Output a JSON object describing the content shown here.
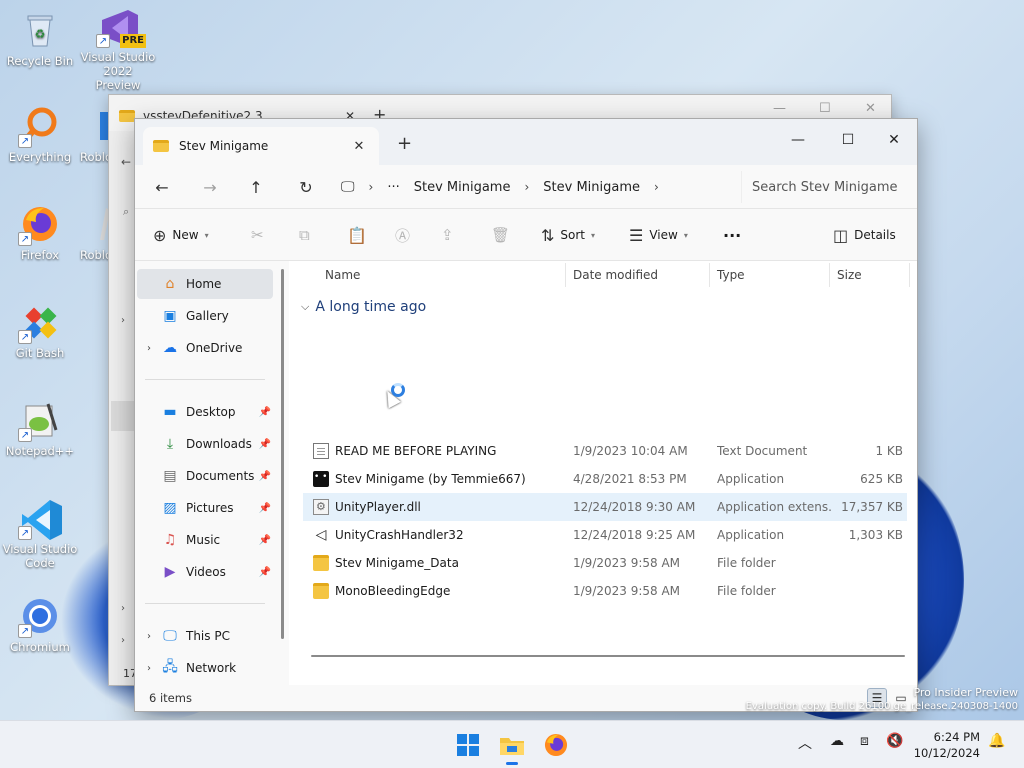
{
  "desktop": {
    "icons": [
      {
        "label": "Recycle Bin",
        "icon": "recycle-bin-icon"
      },
      {
        "label": "Visual Studio 2022 Preview",
        "badge": "PRE",
        "icon": "visual-studio-icon"
      },
      {
        "label": "Everything",
        "icon": "everything-search-icon"
      },
      {
        "label": "Roblo",
        "icon": "roblox-icon"
      },
      {
        "label": "Firefox",
        "icon": "firefox-icon"
      },
      {
        "label": "Roblo",
        "icon": "roblox-studio-icon"
      },
      {
        "label": "Git Bash",
        "icon": "git-bash-icon"
      },
      {
        "label": "Notepad++",
        "icon": "notepad-plus-plus-icon"
      },
      {
        "label": "Visual Studio Code",
        "icon": "vscode-icon"
      },
      {
        "label": "Chromium",
        "icon": "chromium-icon"
      }
    ]
  },
  "background_window": {
    "tab_title": "vsstevDefenitive2.3",
    "status_prefix": "17"
  },
  "window": {
    "tab_title": "Stev Minigame",
    "new_tab": "+",
    "controls": {
      "minimize": "—",
      "maximize": "☐",
      "close": "✕"
    }
  },
  "address": {
    "overflow": "···",
    "crumbs": [
      "Stev Minigame",
      "Stev Minigame"
    ],
    "search_placeholder": "Search Stev Minigame"
  },
  "toolbar": {
    "new_label": "New",
    "sort_label": "Sort",
    "view_label": "View",
    "more_label": "···",
    "details_label": "Details"
  },
  "sidebar": {
    "items": [
      {
        "label": "Home",
        "icon": "home-icon",
        "selected": true
      },
      {
        "label": "Gallery",
        "icon": "gallery-icon"
      },
      {
        "label": "OneDrive",
        "icon": "onedrive-icon",
        "expandable": true
      },
      {
        "label": "Desktop",
        "icon": "desktop-folder-icon",
        "pinned": true
      },
      {
        "label": "Downloads",
        "icon": "downloads-icon",
        "pinned": true
      },
      {
        "label": "Documents",
        "icon": "documents-icon",
        "pinned": true
      },
      {
        "label": "Pictures",
        "icon": "pictures-icon",
        "pinned": true
      },
      {
        "label": "Music",
        "icon": "music-icon",
        "pinned": true
      },
      {
        "label": "Videos",
        "icon": "videos-icon",
        "pinned": true
      },
      {
        "label": "This PC",
        "icon": "this-pc-icon",
        "expandable": true
      },
      {
        "label": "Network",
        "icon": "network-icon",
        "expandable": true
      }
    ]
  },
  "files": {
    "columns": [
      "Name",
      "Date modified",
      "Type",
      "Size"
    ],
    "group_label": "A long time ago",
    "rows": [
      {
        "name": "READ ME BEFORE PLAYING",
        "date": "1/9/2023 10:04 AM",
        "type": "Text Document",
        "size": "1 KB",
        "icon": "text-document-icon"
      },
      {
        "name": "Stev Minigame (by Temmie667)",
        "date": "4/28/2021 8:53 PM",
        "type": "Application",
        "size": "625 KB",
        "icon": "application-icon"
      },
      {
        "name": "UnityPlayer.dll",
        "date": "12/24/2018 9:30 AM",
        "type": "Application extens...",
        "size": "17,357 KB",
        "icon": "dll-file-icon",
        "hover": true
      },
      {
        "name": "UnityCrashHandler32",
        "date": "12/24/2018 9:25 AM",
        "type": "Application",
        "size": "1,303 KB",
        "icon": "unity-icon"
      },
      {
        "name": "Stev Minigame_Data",
        "date": "1/9/2023 9:58 AM",
        "type": "File folder",
        "size": "",
        "icon": "folder-icon"
      },
      {
        "name": "MonoBleedingEdge",
        "date": "1/9/2023 9:58 AM",
        "type": "File folder",
        "size": "",
        "icon": "folder-icon"
      }
    ]
  },
  "status": {
    "item_count": "6 items"
  },
  "watermark": {
    "line1": "Pro Insider Preview",
    "line2": "Evaluation copy. Build 26100.ge_release.240308-1400"
  },
  "taskbar": {
    "apps": [
      "start-icon",
      "file-explorer-icon",
      "firefox-icon"
    ],
    "time": "6:24 PM",
    "date": "10/12/2024"
  }
}
